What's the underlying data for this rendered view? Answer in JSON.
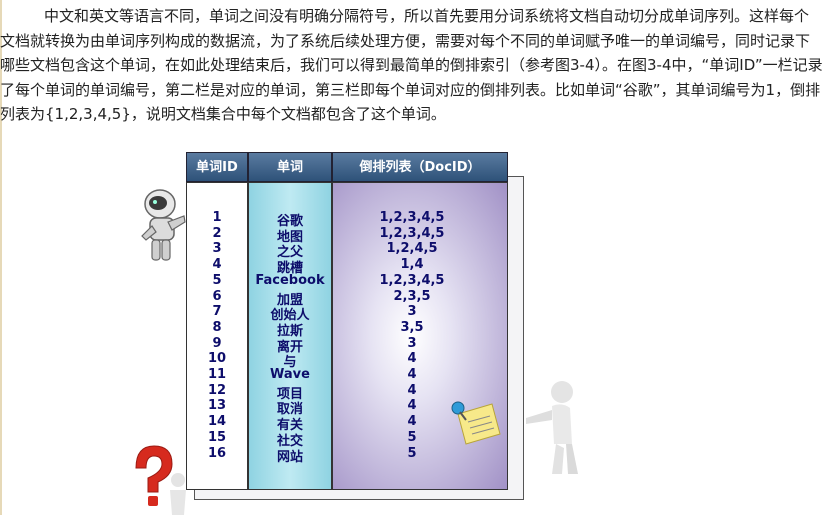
{
  "paragraph": "中文和英文等语言不同，单词之间没有明确分隔符号，所以首先要用分词系统将文档自动切分成单词序列。这样每个文档就转换为由单词序列构成的数据流，为了系统后续处理方便，需要对每个不同的单词赋予唯一的单词编号，同时记录下哪些文档包含这个单词，在如此处理结束后，我们可以得到最简单的倒排索引（参考图3-4）。在图3-4中，“单词ID”一栏记录了每个单词的单词编号，第二栏是对应的单词，第三栏即每个单词对应的倒排列表。比如单词“谷歌”，其单词编号为1，倒排列表为{1,2,3,4,5}，说明文档集合中每个文档都包含了这个单词。",
  "table": {
    "headers": [
      "单词ID",
      "单词",
      "倒排列表（DocID）"
    ],
    "rows": [
      {
        "id": "1",
        "word": "谷歌",
        "list": "1,2,3,4,5"
      },
      {
        "id": "2",
        "word": "地图",
        "list": "1,2,3,4,5"
      },
      {
        "id": "3",
        "word": "之父",
        "list": "1,2,4,5"
      },
      {
        "id": "4",
        "word": "跳槽",
        "list": "1,4"
      },
      {
        "id": "5",
        "word": "Facebook",
        "list": "1,2,3,4,5"
      },
      {
        "id": "6",
        "word": "加盟",
        "list": "2,3,5"
      },
      {
        "id": "7",
        "word": "创始人",
        "list": "3"
      },
      {
        "id": "8",
        "word": "拉斯",
        "list": "3,5"
      },
      {
        "id": "9",
        "word": "离开",
        "list": "3"
      },
      {
        "id": "10",
        "word": "与",
        "list": "4"
      },
      {
        "id": "11",
        "word": "Wave",
        "list": "4"
      },
      {
        "id": "12",
        "word": "项目",
        "list": "4"
      },
      {
        "id": "13",
        "word": "取消",
        "list": "4"
      },
      {
        "id": "14",
        "word": "有关",
        "list": "4"
      },
      {
        "id": "15",
        "word": "社交",
        "list": "5"
      },
      {
        "id": "16",
        "word": "网站",
        "list": "5"
      }
    ]
  },
  "colors": {
    "header": "#2e5279",
    "word_column": "#8fd3e2",
    "list_column": "#a191c6",
    "cell_text": "#0d0d6b"
  },
  "icons": [
    "robot-illustration",
    "standing-person-illustration",
    "question-mark-illustration",
    "pinned-note-icon"
  ]
}
